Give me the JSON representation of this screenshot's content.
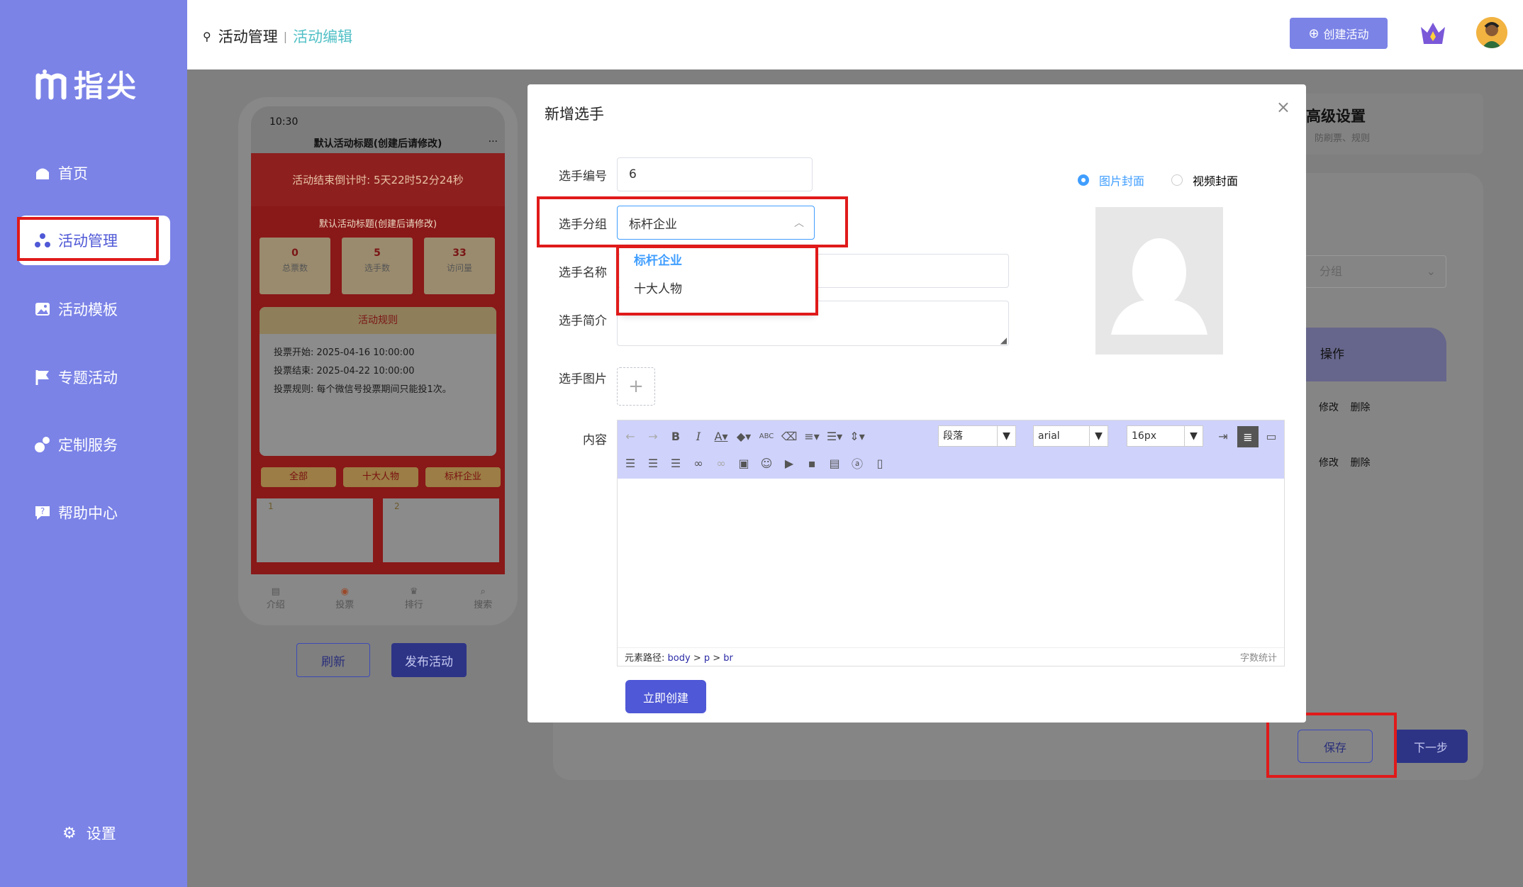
{
  "app": {
    "logo_text": "指尖",
    "brand_color": "#7b83e7",
    "accent_color": "#4f58d6"
  },
  "sidebar": {
    "items": [
      {
        "label": "首页",
        "icon": "home-icon"
      },
      {
        "label": "活动管理",
        "icon": "activity-icon",
        "active": true
      },
      {
        "label": "活动模板",
        "icon": "image-icon"
      },
      {
        "label": "专题活动",
        "icon": "flag-icon"
      },
      {
        "label": "定制服务",
        "icon": "custom-service-icon"
      },
      {
        "label": "帮助中心",
        "icon": "help-icon"
      }
    ],
    "settings_label": "设置"
  },
  "header": {
    "breadcrumb": {
      "root": "活动管理",
      "sep": "|",
      "current": "活动编辑"
    },
    "create_button": "创建活动"
  },
  "phone": {
    "time": "10:30",
    "title": "默认活动标题(创建后请修改)",
    "more": "···",
    "countdown": "活动结束倒计时: 5天22时52分24秒",
    "inner_title": "默认活动标题(创建后请修改)",
    "stats": [
      {
        "value": "0",
        "label": "总票数"
      },
      {
        "value": "5",
        "label": "选手数"
      },
      {
        "value": "33",
        "label": "访问量"
      }
    ],
    "rules_title": "活动规则",
    "rules": [
      "投票开始: 2025-04-16 10:00:00",
      "投票结束: 2025-04-22 10:00:00",
      "投票规则: 每个微信号投票期间只能投1次。"
    ],
    "tabs": [
      "全部",
      "十大人物",
      "标杆企业"
    ],
    "cards": [
      "1",
      "2"
    ],
    "nav": [
      "介绍",
      "投票",
      "排行",
      "搜索"
    ]
  },
  "preview_buttons": {
    "refresh": "刷新",
    "publish": "发布活动"
  },
  "right_panel": {
    "title": "高级设置",
    "subtitle": "防刷票、规则",
    "group_placeholder": "分组",
    "col_header": "操作",
    "rows": [
      {
        "edit": "修改",
        "delete": "删除"
      },
      {
        "edit": "修改",
        "delete": "删除"
      }
    ],
    "save": "保存",
    "next": "下一步"
  },
  "modal": {
    "title": "新增选手",
    "close": "×",
    "fields": {
      "number_label": "选手编号",
      "number_value": "6",
      "group_label": "选手分组",
      "group_value": "标杆企业",
      "name_label": "选手名称",
      "intro_label": "选手简介",
      "image_label": "选手图片",
      "content_label": "内容"
    },
    "group_options": [
      "标杆企业",
      "十大人物"
    ],
    "cover_options": {
      "image": "图片封面",
      "video": "视频封面",
      "selected": "image"
    },
    "editor": {
      "paragraph": "段落",
      "font": "arial",
      "size": "16px",
      "path_label": "元素路径:",
      "path": [
        "body",
        "p",
        "br"
      ],
      "word_count": "字数统计"
    },
    "submit": "立即创建"
  }
}
